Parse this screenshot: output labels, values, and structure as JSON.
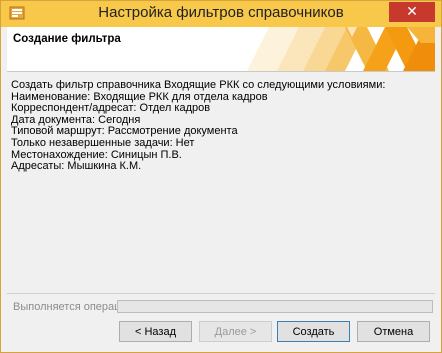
{
  "window": {
    "title": "Настройка фильтров справочников",
    "close_glyph": "✕",
    "icon": "app-filter-icon"
  },
  "header": {
    "title": "Создание фильтра"
  },
  "content": {
    "lines": [
      "Создать фильтр справочника Входящие РКК со следующими условиями:",
      "Наименование: Входящие РКК для отдела кадров",
      "Корреспондент/адресат: Отдел кадров",
      "Дата документа: Сегодня",
      "Типовой маршрут: Рассмотрение документа",
      "Только незавершенные задачи: Нет",
      "Местонахождение: Синицын П.В.",
      "Адресаты: Мышкина К.М."
    ]
  },
  "progress": {
    "label": "Выполняется операция",
    "value": 0
  },
  "buttons": {
    "back": "< Назад",
    "next": "Далее >",
    "create": "Создать",
    "cancel": "Отмена"
  },
  "colors": {
    "titlebar": "#f7c84a",
    "accent_orange": "#f5a21a",
    "close": "#c7392c"
  }
}
